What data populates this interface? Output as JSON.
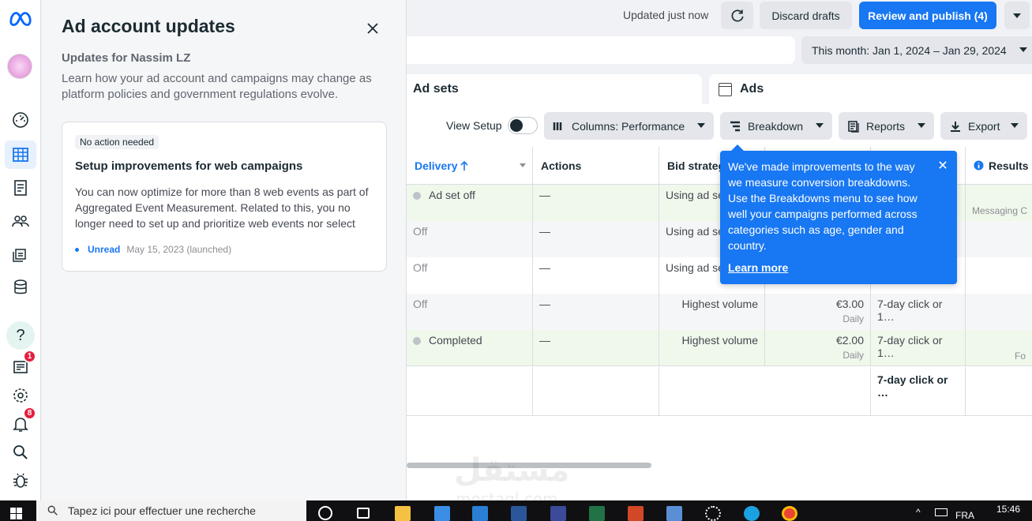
{
  "rail": {
    "logo": "meta-logo",
    "items": [
      {
        "name": "account-overview",
        "icon": "gauge-icon"
      },
      {
        "name": "campaigns",
        "icon": "table-icon",
        "active": true
      },
      {
        "name": "ads-reporting",
        "icon": "report-icon"
      },
      {
        "name": "audiences",
        "icon": "people-icon"
      },
      {
        "name": "advertising-settings",
        "icon": "stack-icon"
      },
      {
        "name": "billing",
        "icon": "database-icon"
      }
    ],
    "bottom": [
      {
        "name": "help",
        "icon": "help-icon"
      },
      {
        "name": "ad-account-updates",
        "icon": "news-icon",
        "badge": "1"
      },
      {
        "name": "settings",
        "icon": "gear-icon"
      },
      {
        "name": "notifications",
        "icon": "bell-icon",
        "badge": "8"
      },
      {
        "name": "search",
        "icon": "search-icon"
      },
      {
        "name": "report-bug",
        "icon": "bug-icon"
      }
    ]
  },
  "panel": {
    "title": "Ad account updates",
    "subtitle": "Updates for Nassim LZ",
    "description": "Learn how your ad account and campaigns may change as platform policies and government regulations evolve.",
    "card": {
      "chip": "No action needed",
      "title": "Setup improvements for web campaigns",
      "body": "You can now optimize for more than 8 web events as part of Aggregated Event Measurement. Related to this, you no longer need to set up and prioritize web events nor select a…",
      "status": "Unread",
      "date": "May 15, 2023 (launched)"
    }
  },
  "header": {
    "updated": "Updated just now",
    "discard": "Discard drafts",
    "publish": "Review and publish (4)",
    "date_range": "This month: Jan 1, 2024 – Jan 29, 2024"
  },
  "tabs": {
    "adsets": "Ad sets",
    "ads": "Ads"
  },
  "toolbar": {
    "view_setup": "View Setup",
    "columns": "Columns: Performance",
    "breakdown": "Breakdown",
    "reports": "Reports",
    "export": "Export"
  },
  "table": {
    "headers": {
      "delivery": "Delivery",
      "actions": "Actions",
      "bid_strategy": "Bid strateg",
      "results": "Results"
    },
    "rows": [
      {
        "delivery": "Ad set off",
        "dot": true,
        "actions": "—",
        "bid": "Using ad se",
        "budget": "",
        "budget_sub": "",
        "attribution": "",
        "results_sub": "Messaging C"
      },
      {
        "delivery": "Off",
        "dot": false,
        "actions": "—",
        "bid": "Using ad se",
        "budget": "",
        "budget_sub": "",
        "attribution": "",
        "results_sub": ""
      },
      {
        "delivery": "Off",
        "dot": false,
        "actions": "—",
        "bid": "Using ad se",
        "budget": "",
        "budget_sub": "",
        "attribution": "",
        "results_sub": ""
      },
      {
        "delivery": "Off",
        "dot": false,
        "actions": "—",
        "bid": "Highest volume",
        "budget": "€3.00",
        "budget_sub": "Daily",
        "attribution": "7-day click or 1…",
        "results_sub": ""
      },
      {
        "delivery": "Completed",
        "dot": true,
        "actions": "—",
        "bid": "Highest volume",
        "budget": "€2.00",
        "budget_sub": "Daily",
        "attribution": "7-day click or 1…",
        "results_sub": "Fo"
      }
    ],
    "total_attribution": "7-day click or …"
  },
  "tooltip": {
    "text": "We've made improvements to the way we measure conversion breakdowns. Use the Breakdowns menu to see how well your campaigns performed across categories such as age, gender and country.",
    "link": "Learn more"
  },
  "watermark": {
    "main": "مستقل",
    "sub": "mostaql.com"
  },
  "taskbar": {
    "search_placeholder": "Tapez ici pour effectuer une recherche",
    "lang": "FRA",
    "time": "15:46"
  },
  "colors": {
    "accent": "#1877f2",
    "badge": "#e41e3f",
    "row_highlight": "#f0f8ec"
  }
}
